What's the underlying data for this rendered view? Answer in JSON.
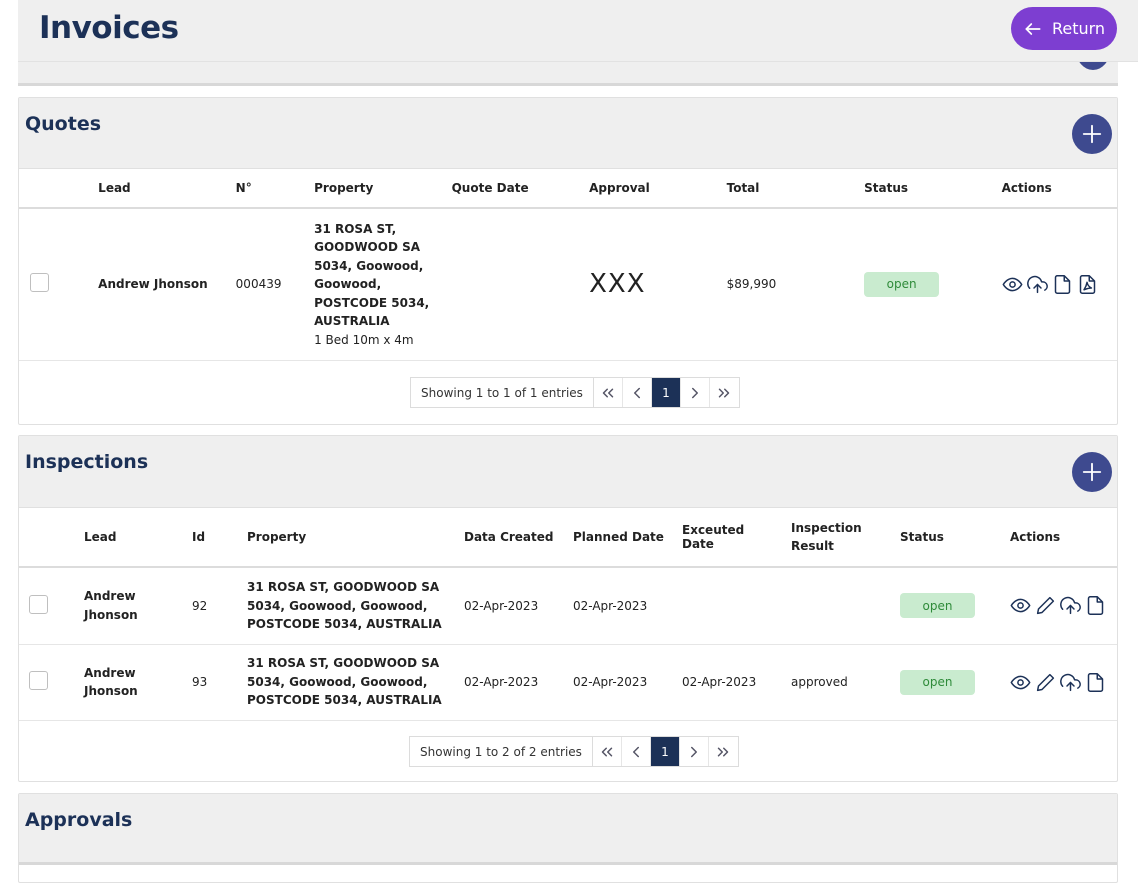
{
  "header": {
    "title": "Invoices",
    "return_label": "Return"
  },
  "quotes": {
    "title": "Quotes",
    "columns": [
      "Lead",
      "N°",
      "Property",
      "Quote Date",
      "Approval",
      "Total",
      "Status",
      "Actions"
    ],
    "rows": [
      {
        "lead": "Andrew Jhonson",
        "number": "000439",
        "property_lines": [
          "31 ROSA ST,",
          "GOODWOOD SA",
          "5034, Goowood,",
          "Goowood,",
          "POSTCODE 5034,",
          "AUSTRALIA"
        ],
        "property_sub": "1 Bed 10m x 4m",
        "quote_date": "",
        "approval": "XXX",
        "total": "$89,990",
        "status": "open"
      }
    ],
    "pagination": {
      "info": "Showing 1 to 1 of 1 entries",
      "current_page": "1"
    }
  },
  "inspections": {
    "title": "Inspections",
    "columns": [
      "Lead",
      "Id",
      "Property",
      "Data Created",
      "Planned Date",
      "Exceuted Date",
      "Inspection Result",
      "Status",
      "Actions"
    ],
    "rows": [
      {
        "lead_lines": [
          "Andrew",
          "Jhonson"
        ],
        "id": "92",
        "property_lines": [
          "31 ROSA ST, GOODWOOD SA",
          "5034, Goowood, Goowood,",
          "POSTCODE 5034, AUSTRALIA"
        ],
        "data_created": "02-Apr-2023",
        "planned_date": "02-Apr-2023",
        "executed_date": "",
        "result": "",
        "status": "open"
      },
      {
        "lead_lines": [
          "Andrew",
          "Jhonson"
        ],
        "id": "93",
        "property_lines": [
          "31 ROSA ST, GOODWOOD SA",
          "5034, Goowood, Goowood,",
          "POSTCODE 5034, AUSTRALIA"
        ],
        "data_created": "02-Apr-2023",
        "planned_date": "02-Apr-2023",
        "executed_date": "02-Apr-2023",
        "result": "approved",
        "status": "open"
      }
    ],
    "pagination": {
      "info": "Showing 1 to 2 of 2 entries",
      "current_page": "1"
    }
  },
  "approvals": {
    "title": "Approvals"
  },
  "colors": {
    "brand_navy": "#1c3157",
    "accent_purple": "#7d3ed1",
    "add_button": "#3e4a8f",
    "status_open_bg": "#c9ebcf",
    "status_open_text": "#2f8b3a"
  },
  "icons": {
    "return": "arrow-left-icon",
    "add": "plus-icon",
    "view": "eye-icon",
    "edit": "pencil-icon",
    "upload": "cloud-upload-icon",
    "document": "file-icon",
    "pdf": "file-pdf-icon",
    "first": "chevrons-left-icon",
    "prev": "chevron-left-icon",
    "next": "chevron-right-icon",
    "last": "chevrons-right-icon"
  }
}
